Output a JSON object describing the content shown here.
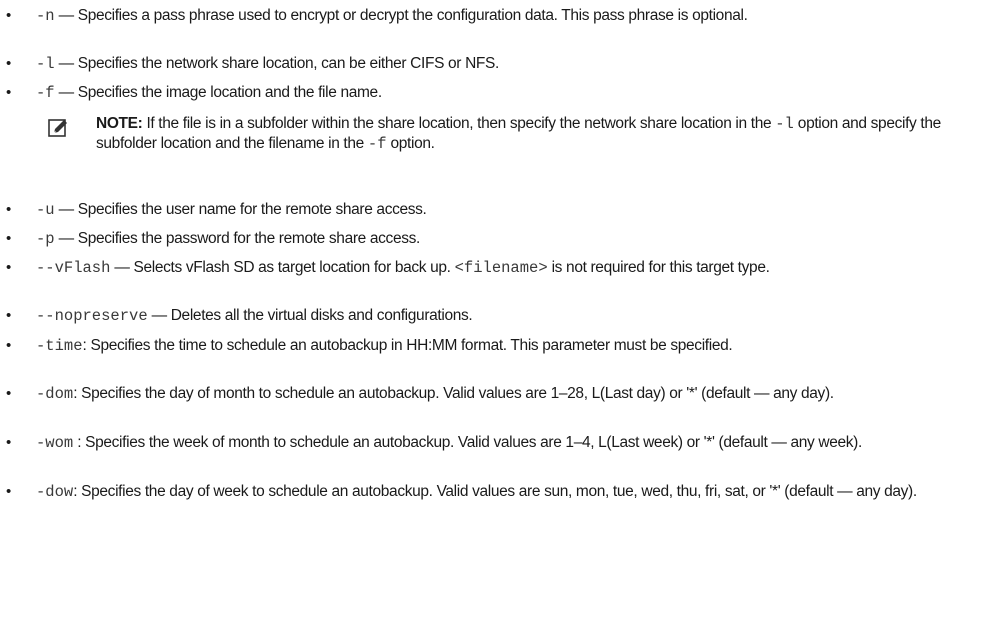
{
  "bullet_glyph": "•",
  "dash": "—",
  "items": [
    {
      "code": "-n",
      "sep": "—",
      "text": "Specifies a pass phrase used to encrypt or decrypt the configuration data. This pass phrase is optional."
    },
    {
      "code": "-l",
      "sep": "—",
      "text": "Specifies the network share location, can be either CIFS or NFS."
    },
    {
      "code": "-f",
      "sep": "—",
      "text": "Specifies the image location and the file name."
    },
    {
      "code": "-u",
      "sep": "—",
      "text": "Specifies the user name for the remote share access."
    },
    {
      "code": "-p",
      "sep": "—",
      "text": "Specifies the password for the remote share access."
    },
    {
      "code": "--vFlash",
      "sep": "—",
      "text": "Selects vFlash SD as target location for back up.",
      "code2": "<filename>",
      "text2": "is not required for this target type."
    },
    {
      "code": "--nopreserve",
      "sep": "—",
      "text": "Deletes all the virtual disks and configurations."
    },
    {
      "code": "-time",
      "sep": ":",
      "text": "Specifies the time to schedule an autobackup in HH:MM format. This parameter must be specified."
    },
    {
      "code": "-dom",
      "sep": ":",
      "text": "Specifies the day of month to schedule an autobackup. Valid values are 1–28, L(Last day) or '*' (default — any day)."
    },
    {
      "code": "-wom",
      "sep": ":",
      "text": "Specifies the week of month to schedule an autobackup. Valid values are 1–4, L(Last week) or '*' (default — any week)."
    },
    {
      "code": "-dow",
      "sep": ":",
      "text": "Specifies the day of week to schedule an autobackup. Valid values are sun, mon, tue, wed, thu, fri, sat, or '*' (default — any day)."
    }
  ],
  "note": {
    "icon": "pencil-note-icon",
    "label": "NOTE:",
    "text_a": "If the file is in a subfolder within the share location, then specify the network share location in the",
    "code_a": "-l",
    "text_b": "option and specify the subfolder location and the filename in the",
    "code_b": "-f",
    "text_c": "option."
  }
}
